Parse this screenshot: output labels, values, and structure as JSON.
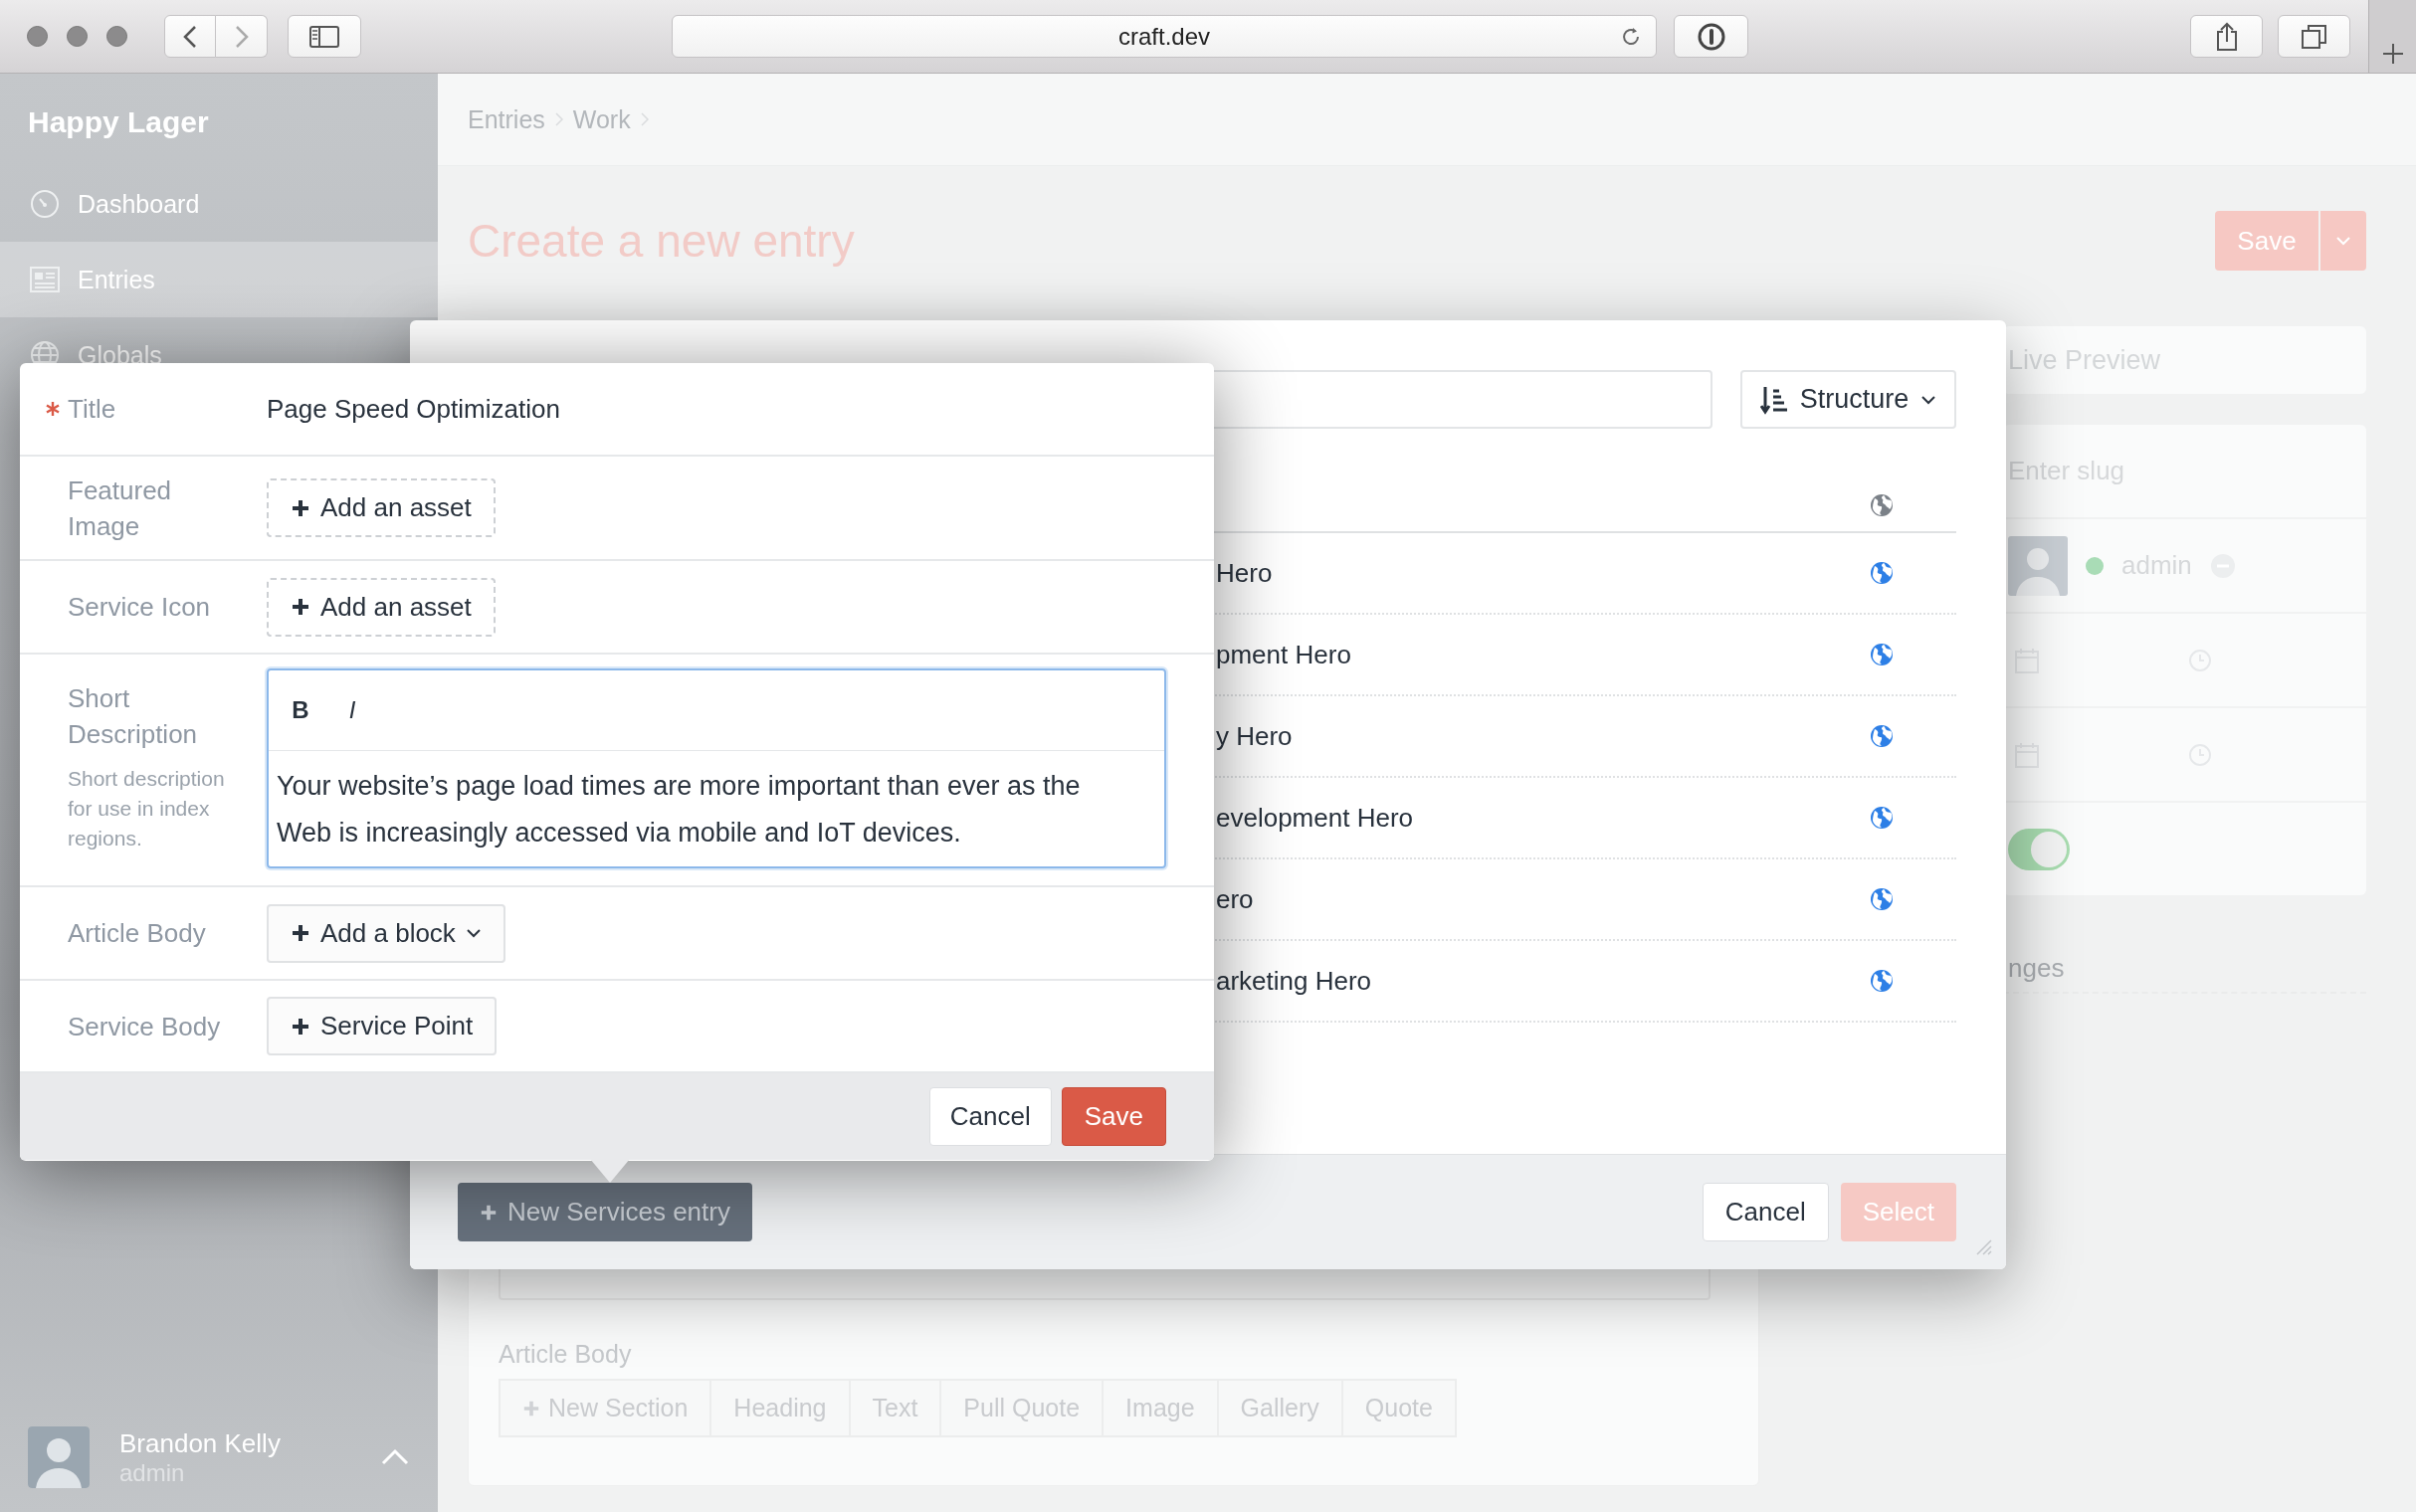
{
  "browser": {
    "url": "craft.dev"
  },
  "sidebar": {
    "site_name": "Happy Lager",
    "nav": [
      {
        "label": "Dashboard",
        "selected": false
      },
      {
        "label": "Entries",
        "selected": true
      },
      {
        "label": "Globals",
        "selected": false
      }
    ],
    "user": {
      "name": "Brandon Kelly",
      "role": "admin"
    }
  },
  "page": {
    "breadcrumbs": [
      "Entries",
      "Work"
    ],
    "title": "Create a new entry",
    "save_button": "Save",
    "article_body": {
      "label": "Article Body",
      "add_button": "New Section",
      "block_types": [
        "Heading",
        "Text",
        "Pull Quote",
        "Image",
        "Gallery",
        "Quote"
      ]
    },
    "side_panel": {
      "live_preview": "Live Preview",
      "slug_placeholder": "Enter slug",
      "author": "admin",
      "enabled": true,
      "section_label": "nges"
    }
  },
  "entry_selector": {
    "sort_button": "Structure",
    "rows": [
      {
        "title": "Hero"
      },
      {
        "title": "pment Hero"
      },
      {
        "title": "y Hero"
      },
      {
        "title": "evelopment Hero"
      },
      {
        "title": "ero"
      },
      {
        "title": "arketing Hero"
      }
    ],
    "new_entry_button": "New Services entry",
    "cancel_button": "Cancel",
    "select_button": {
      "label": "Select",
      "disabled": true
    }
  },
  "entry_editor": {
    "fields": [
      {
        "kind": "text",
        "label": "Title",
        "required": true,
        "value": "Page Speed Optimization"
      },
      {
        "kind": "assets",
        "label": "Featured Image",
        "required": false,
        "button": "Add an asset"
      },
      {
        "kind": "assets",
        "label": "Service Icon",
        "required": false,
        "button": "Add an asset"
      },
      {
        "kind": "richtext",
        "label": "Short Description",
        "required": false,
        "instructions": "Short description for use in index regions.",
        "toolbar": [
          {
            "kind": "bold",
            "label": "B"
          },
          {
            "kind": "italic",
            "label": "I"
          }
        ],
        "value": "Your website’s page load times are more important than ever as the Web is increasingly accessed via mobile and IoT devices."
      },
      {
        "kind": "blocks",
        "label": "Article Body",
        "required": false,
        "button": "Add a block"
      },
      {
        "kind": "button",
        "label": "Service Body",
        "required": false,
        "button": "Service Point"
      }
    ],
    "cancel_button": "Cancel",
    "save_button": "Save"
  }
}
